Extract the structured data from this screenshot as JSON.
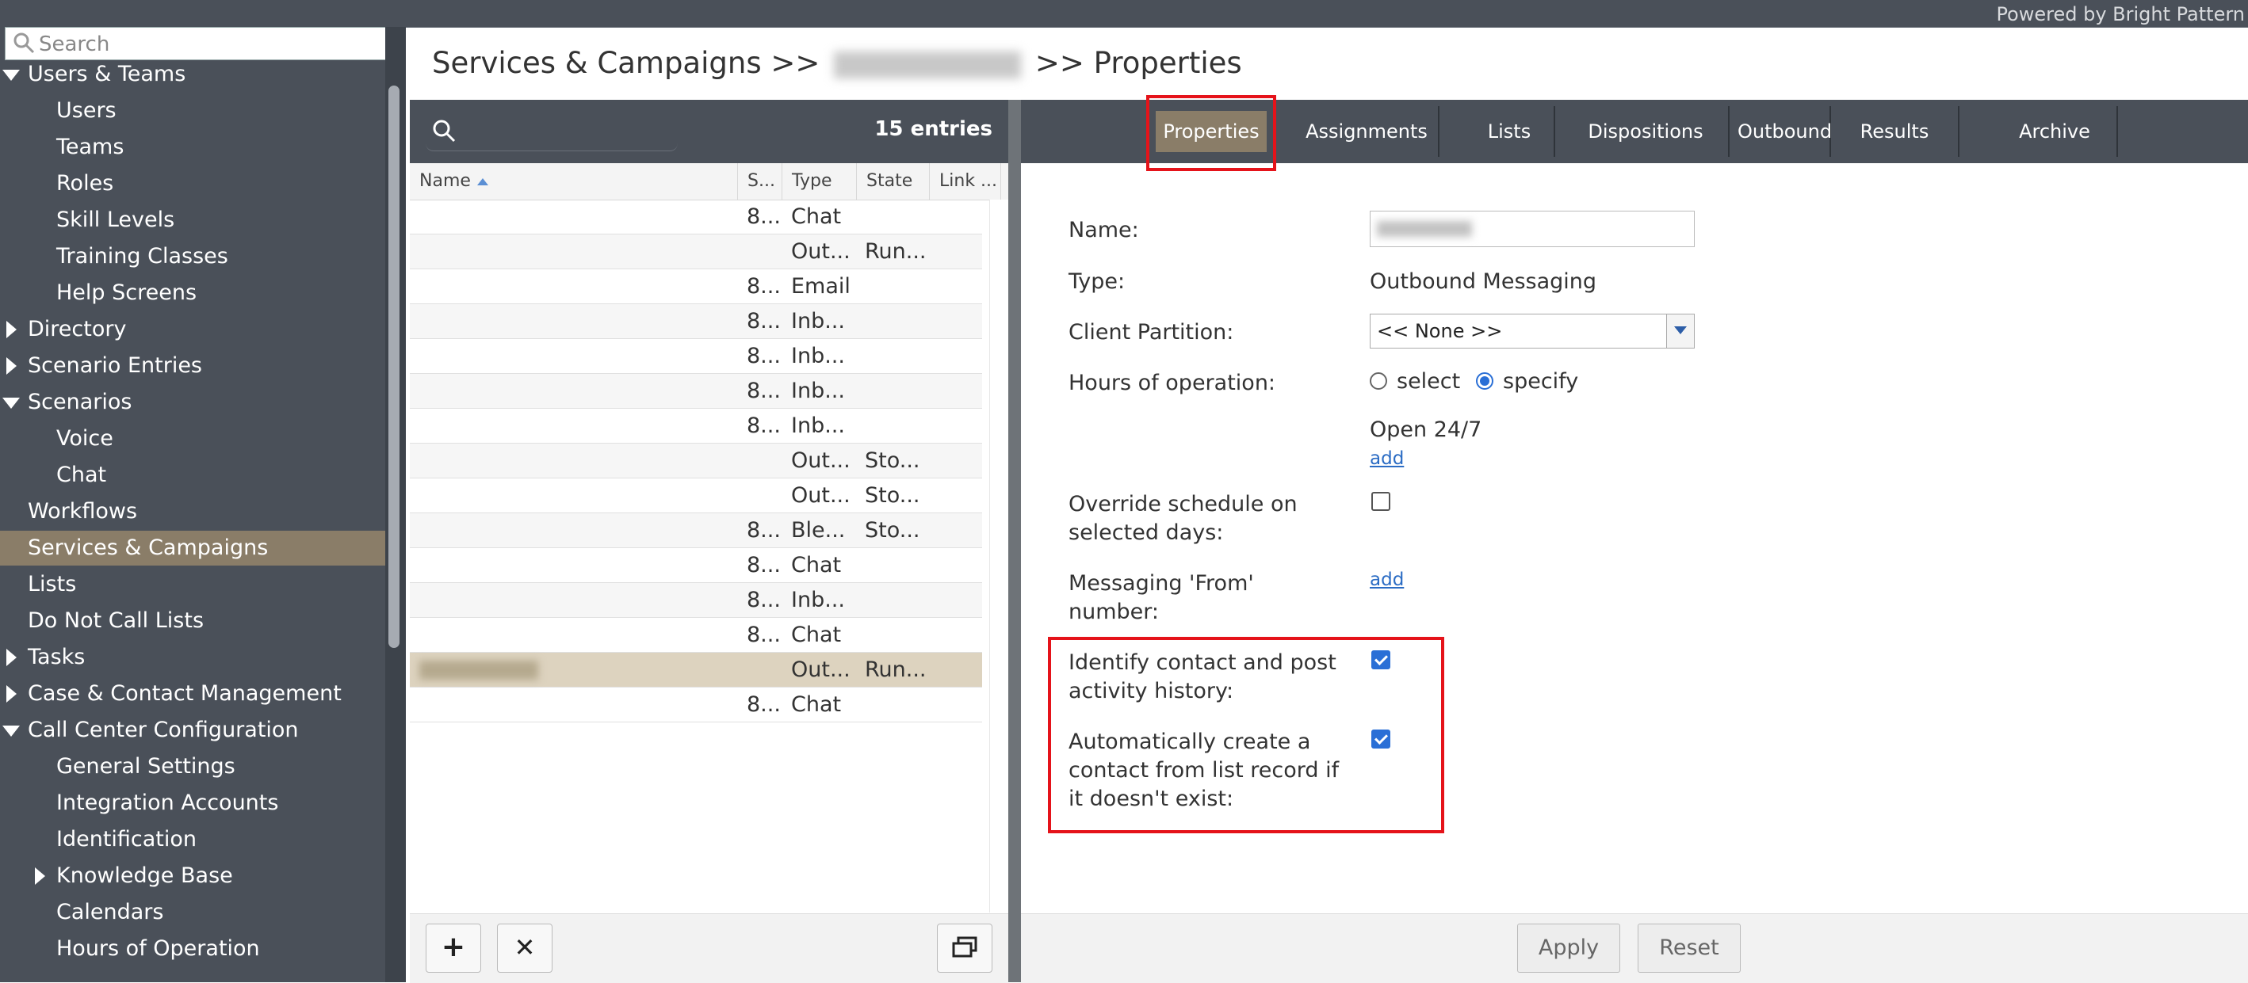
{
  "topbar": {
    "powered_by": "Powered by Bright Pattern"
  },
  "sidebar": {
    "search_placeholder": "Search",
    "items": [
      {
        "label": "Users & Teams",
        "expander": "down"
      },
      {
        "label": "Users"
      },
      {
        "label": "Teams"
      },
      {
        "label": "Roles"
      },
      {
        "label": "Skill Levels"
      },
      {
        "label": "Training Classes"
      },
      {
        "label": "Help Screens"
      },
      {
        "label": "Directory",
        "expander": "right"
      },
      {
        "label": "Scenario Entries",
        "expander": "right"
      },
      {
        "label": "Scenarios",
        "expander": "down"
      },
      {
        "label": "Voice"
      },
      {
        "label": "Chat"
      },
      {
        "label": "Workflows"
      },
      {
        "label": "Services & Campaigns",
        "selected": true
      },
      {
        "label": "Lists"
      },
      {
        "label": "Do Not Call Lists"
      },
      {
        "label": "Tasks",
        "expander": "right"
      },
      {
        "label": "Case & Contact Management",
        "expander": "right"
      },
      {
        "label": "Call Center Configuration",
        "expander": "down"
      },
      {
        "label": "General Settings"
      },
      {
        "label": "Integration Accounts"
      },
      {
        "label": "Identification"
      },
      {
        "label": "Knowledge Base",
        "expander": "right"
      },
      {
        "label": "Calendars"
      },
      {
        "label": "Hours of Operation"
      }
    ]
  },
  "header": {
    "title_prefix": "Services & Campaigns >>",
    "title_suffix": ">> Properties"
  },
  "list": {
    "entries": "15 entries",
    "columns": [
      "Name",
      "S...",
      "Type",
      "State",
      "Link ..."
    ],
    "rows": [
      {
        "s": "8...",
        "type": "Chat",
        "state": ""
      },
      {
        "s": "",
        "type": "Out...",
        "state": "Run..."
      },
      {
        "s": "8...",
        "type": "Email",
        "state": ""
      },
      {
        "s": "8...",
        "type": "Inb...",
        "state": ""
      },
      {
        "s": "8...",
        "type": "Inb...",
        "state": ""
      },
      {
        "s": "8...",
        "type": "Inb...",
        "state": ""
      },
      {
        "s": "8...",
        "type": "Inb...",
        "state": ""
      },
      {
        "s": "",
        "type": "Out...",
        "state": "Sto..."
      },
      {
        "s": "",
        "type": "Out...",
        "state": "Sto..."
      },
      {
        "s": "8...",
        "type": "Ble...",
        "state": "Sto..."
      },
      {
        "s": "8...",
        "type": "Chat",
        "state": ""
      },
      {
        "s": "8...",
        "type": "Inb...",
        "state": ""
      },
      {
        "s": "8...",
        "type": "Chat",
        "state": ""
      },
      {
        "s": "",
        "type": "Out...",
        "state": "Run...",
        "selected": true
      },
      {
        "s": "8...",
        "type": "Chat",
        "state": ""
      }
    ],
    "add_label": "+",
    "delete_label": "✕"
  },
  "tabs": [
    "Properties",
    "Assignments",
    "Lists",
    "Dispositions",
    "Outbound",
    "Results",
    "Archive"
  ],
  "form": {
    "name_label": "Name:",
    "type_label": "Type:",
    "type_value": "Outbound Messaging",
    "partition_label": "Client Partition:",
    "partition_value": "<< None >>",
    "hours_label": "Hours of operation:",
    "hours_select": "select",
    "hours_specify": "specify",
    "hours_value": "Open 24/7",
    "add_link": "add",
    "override_label_1": "Override schedule on",
    "override_label_2": "selected days:",
    "from_label_1": "Messaging 'From'",
    "from_label_2": "number:",
    "identify_label_1": "Identify contact and post",
    "identify_label_2": "activity history:",
    "auto_label_1": "Automatically create a",
    "auto_label_2": "contact from list record if",
    "auto_label_3": "it doesn't exist:",
    "override_checked": false,
    "identify_checked": true,
    "auto_checked": true
  },
  "footer": {
    "apply": "Apply",
    "reset": "Reset"
  },
  "colors": {
    "accent_selected": "#8a7d68",
    "highlight": "#e5131a",
    "link": "#2b6cc4"
  }
}
